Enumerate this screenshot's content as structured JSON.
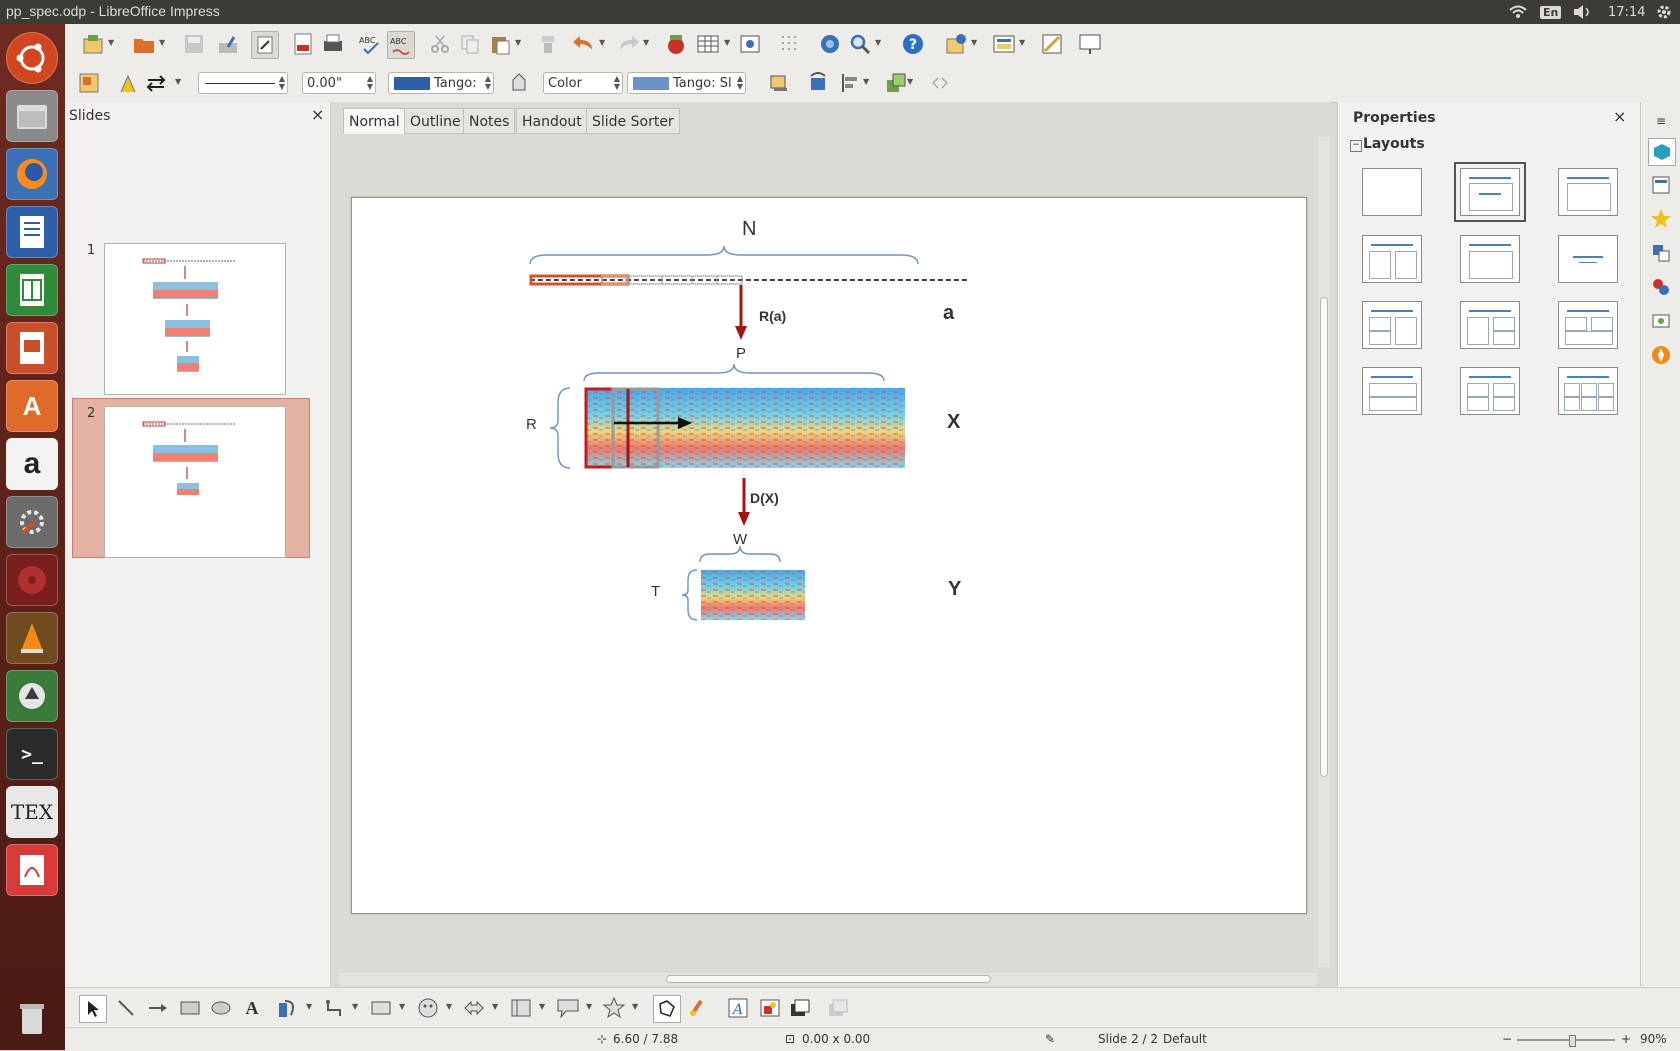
{
  "window": {
    "title": "pp_spec.odp - LibreOffice Impress"
  },
  "tray": {
    "lang": "En",
    "time": "17:14"
  },
  "launcher": [
    "dash-icon",
    "files-icon",
    "firefox-icon",
    "writer-icon",
    "calc-icon",
    "impress-icon",
    "software-center-icon",
    "amazon-icon",
    "system-settings-icon",
    "disk-icon",
    "vlc-icon",
    "updater-icon",
    "terminal-icon",
    "tex-icon",
    "pdf-viewer-icon",
    "trash-icon"
  ],
  "toolbar2": {
    "line_width": "0.00\"",
    "line_color": "Tango:",
    "fill_type": "Color",
    "fill_color": "Tango: Sl"
  },
  "slides_panel": {
    "title": "Slides",
    "close": "×",
    "slides": [
      {
        "number": "1"
      },
      {
        "number": "2"
      }
    ]
  },
  "tabs": [
    "Normal",
    "Outline",
    "Notes",
    "Handout",
    "Slide Sorter"
  ],
  "slide_content": {
    "label_n": "N",
    "label_a": "a",
    "label_ra": "R(a)",
    "label_p": "P",
    "label_r": "R",
    "label_x": "X",
    "label_dx": "D(X)",
    "label_w": "W",
    "label_t": "T",
    "label_y": "Y"
  },
  "properties": {
    "title": "Properties",
    "close": "×",
    "section": "Layouts",
    "selected_layout": 1
  },
  "status": {
    "position": "6.60 / 7.88",
    "size": "0.00 x 0.00",
    "slide": "Slide 2 / 2",
    "master": "Default",
    "zoom": "90%"
  },
  "colors": {
    "accent_red": "#a31515",
    "brace_blue": "#6b93c6",
    "selected_slide": "#e3b2a2"
  }
}
